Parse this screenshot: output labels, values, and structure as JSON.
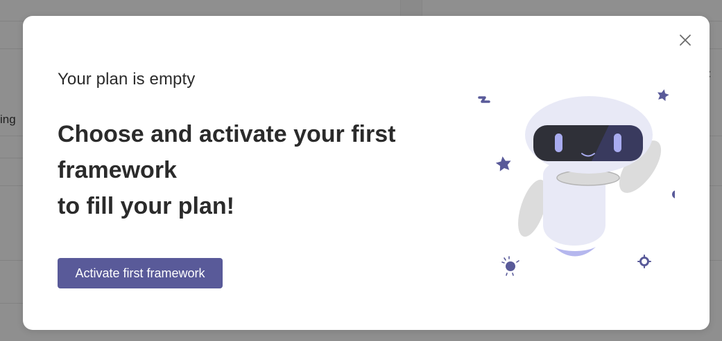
{
  "background": {
    "partial_text": "ing",
    "close_glyph": "×"
  },
  "modal": {
    "close_icon": "close-icon",
    "subtitle": "Your plan is empty",
    "headline_line1": "Choose and activate your first",
    "headline_line2": "framework",
    "headline_line3": "to fill your plan!",
    "cta_label": "Activate first framework",
    "illustration": "robot-waving-illustration"
  },
  "colors": {
    "accent": "#595a99",
    "text": "#2b2b2b",
    "overlay": "#8f8f8f"
  }
}
